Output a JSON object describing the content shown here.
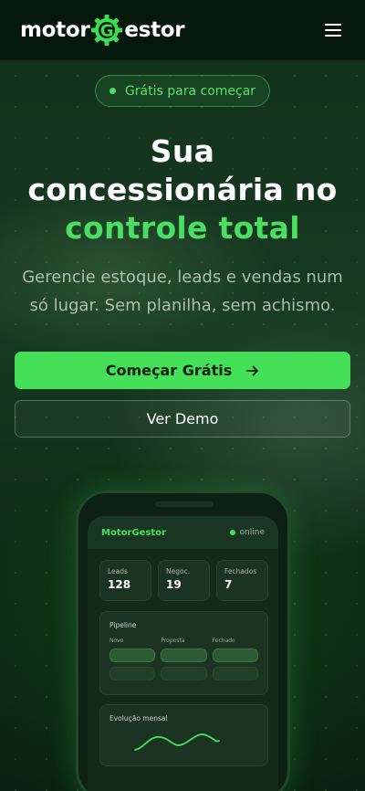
{
  "brand": {
    "name_part1": "motor",
    "name_gear_letter": "G",
    "name_part2": "estor",
    "accent_color": "#4ade62"
  },
  "header": {
    "menu_icon": "hamburger-menu-icon"
  },
  "badge": {
    "label": "Grátis para começar"
  },
  "hero": {
    "line1": "Sua",
    "line2": "concessionária no",
    "line3_accent": "controle total",
    "subtitle": "Gerencie estoque, leads e vendas num só lugar. Sem planilha, sem achismo."
  },
  "cta": {
    "primary_label": "Começar Grátis",
    "primary_icon": "arrow-right-icon",
    "secondary_label": "Ver Demo"
  },
  "mockup": {
    "app_title": "MotorGestor",
    "status": "online",
    "stats": [
      {
        "label": "Leads",
        "value": "128"
      },
      {
        "label": "Negoc.",
        "value": "19"
      },
      {
        "label": "Fechados",
        "value": "7"
      }
    ],
    "pipeline": {
      "title": "Pipeline",
      "columns": [
        "Novo",
        "Proposta",
        "Fechado"
      ]
    },
    "evolution": {
      "title": "Evolução mensal"
    }
  }
}
